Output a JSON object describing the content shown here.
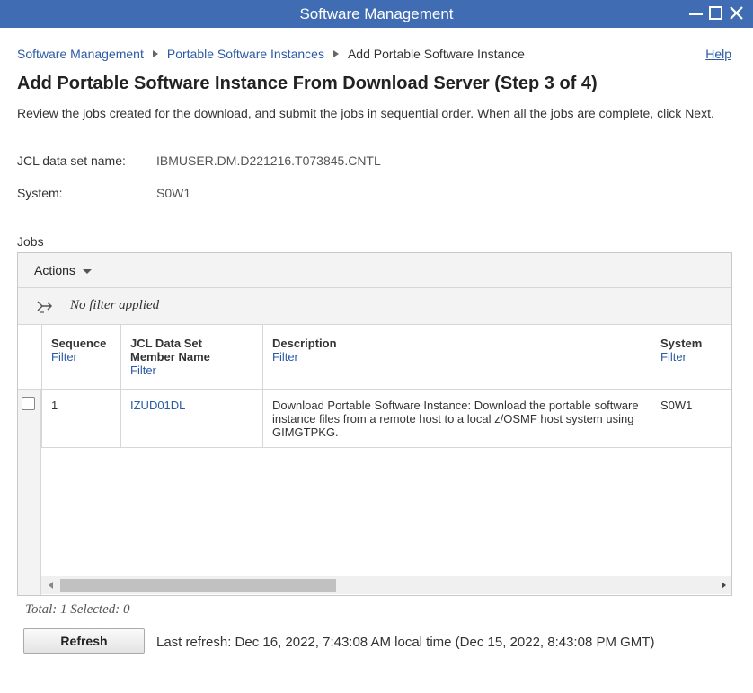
{
  "window": {
    "title": "Software Management",
    "controls": [
      "minimize-icon",
      "maximize-icon",
      "close-icon"
    ]
  },
  "breadcrumb": {
    "items": [
      "Software Management",
      "Portable Software Instances"
    ],
    "current": "Add Portable Software Instance"
  },
  "help_label": "Help",
  "page_title": "Add Portable Software Instance From Download Server (Step 3 of 4)",
  "intro_text": "Review the jobs created for the download, and submit the jobs in sequential order. When all the jobs are complete, click Next.",
  "fields": {
    "jcl_label": "JCL data set name:",
    "jcl_value": "IBMUSER.DM.D221216.T073845.CNTL",
    "system_label": "System:",
    "system_value": "S0W1"
  },
  "jobs": {
    "label": "Jobs",
    "actions_label": "Actions",
    "filter_status": "No filter applied",
    "columns": [
      {
        "line1": "Sequence",
        "line2": "",
        "filter": "Filter"
      },
      {
        "line1": "JCL Data Set",
        "line2": "Member Name",
        "filter": "Filter"
      },
      {
        "line1": "Description",
        "line2": "",
        "filter": "Filter"
      },
      {
        "line1": "System",
        "line2": "",
        "filter": "Filter"
      }
    ],
    "rows": [
      {
        "sequence": "1",
        "member": "IZUD01DL",
        "description": "Download Portable Software Instance:  Download the portable software instance files from a remote host to a local z/OSMF host system using GIMGTPKG.",
        "system": "S0W1"
      }
    ],
    "totals": "Total: 1 Selected: 0"
  },
  "refresh": {
    "button_label": "Refresh",
    "last_refresh": "Last refresh: Dec 16, 2022, 7:43:08 AM local time (Dec 15, 2022, 8:43:08 PM GMT)"
  },
  "colors": {
    "titlebar": "#3f6cb3",
    "link": "#2b5aa3"
  }
}
